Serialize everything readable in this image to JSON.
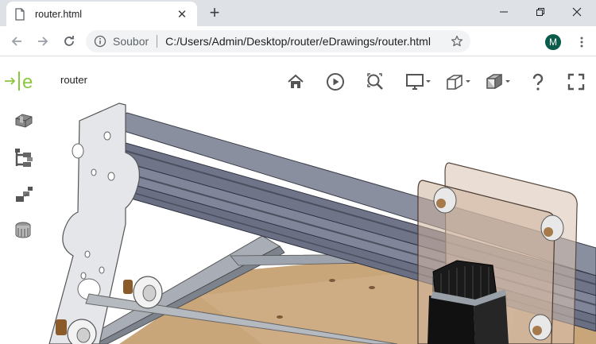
{
  "browser": {
    "tab_title": "router.html",
    "tab_close": "✕",
    "new_tab": "+",
    "omnibox_label": "Soubor",
    "url": "C:/Users/Admin/Desktop/router/eDrawings/router.html",
    "profile_initial": "M"
  },
  "viewer": {
    "model_name": "router",
    "logo_letter": "e",
    "toolbar": [
      "home-icon",
      "play-icon",
      "zoom-to-fit-icon",
      "display-mode-icon",
      "section-icon",
      "view-orientation-icon",
      "help-icon",
      "fullscreen-icon"
    ],
    "sidebar": [
      "parts-icon",
      "tree-icon",
      "explode-icon",
      "appearance-icon"
    ],
    "colors": {
      "accent": "#8dc63f",
      "icon": "#555555",
      "avatar": "#0b5b4a"
    }
  }
}
